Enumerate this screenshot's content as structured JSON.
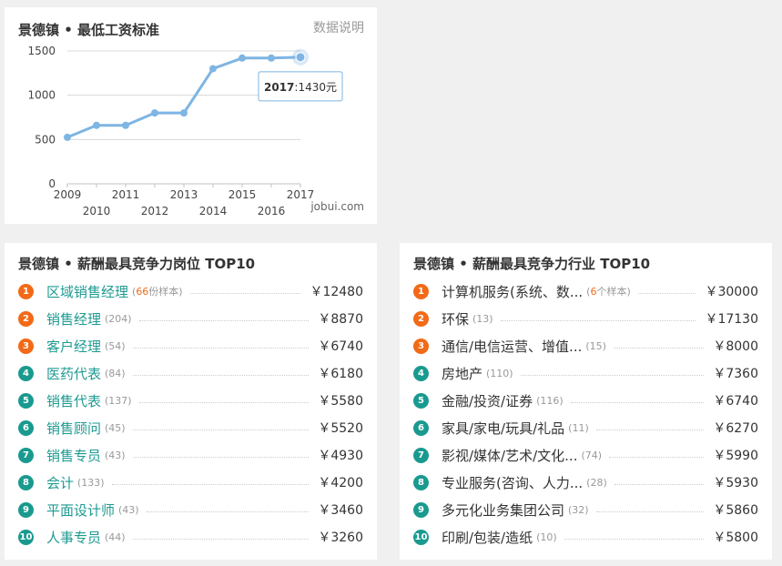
{
  "chart_panel": {
    "title": "景德镇 • 最低工资标准",
    "data_note": "数据说明",
    "source": "jobui.com",
    "tooltip_year": "2017",
    "tooltip_value": ":1430元",
    "accent": "#7eb5e3"
  },
  "chart_data": {
    "type": "line",
    "title": "景德镇 • 最低工资标准",
    "x": [
      2009,
      2010,
      2011,
      2012,
      2013,
      2014,
      2015,
      2016,
      2017
    ],
    "series": [
      {
        "values": [
          525,
          660,
          660,
          800,
          800,
          1300,
          1420,
          1420,
          1430
        ]
      }
    ],
    "x_tick_labels": [
      "2009",
      "2010",
      "2011",
      "2012",
      "2013",
      "2014",
      "2015",
      "2016",
      "2017"
    ],
    "y_ticks": [
      0,
      500,
      1000,
      1500
    ],
    "ylim": [
      0,
      1500
    ],
    "grid": true,
    "highlight_index": 8
  },
  "jobs_panel": {
    "title": "景德镇 • 薪酬最具竞争力岗位 TOP10",
    "items": [
      {
        "rank": "1",
        "name": "区域销售经理",
        "count_prefix": "(",
        "count_num": "66",
        "count_suffix": "份样本)",
        "salary": "￥12480"
      },
      {
        "rank": "2",
        "name": "销售经理",
        "count": "(204)",
        "salary": "￥8870"
      },
      {
        "rank": "3",
        "name": "客户经理",
        "count": "(54)",
        "salary": "￥6740"
      },
      {
        "rank": "4",
        "name": "医药代表",
        "count": "(84)",
        "salary": "￥6180"
      },
      {
        "rank": "5",
        "name": "销售代表",
        "count": "(137)",
        "salary": "￥5580"
      },
      {
        "rank": "6",
        "name": "销售顾问",
        "count": "(45)",
        "salary": "￥5520"
      },
      {
        "rank": "7",
        "name": "销售专员",
        "count": "(43)",
        "salary": "￥4930"
      },
      {
        "rank": "8",
        "name": "会计",
        "count": "(133)",
        "salary": "￥4200"
      },
      {
        "rank": "9",
        "name": "平面设计师",
        "count": "(43)",
        "salary": "￥3460"
      },
      {
        "rank": "10",
        "name": "人事专员",
        "count": "(44)",
        "salary": "￥3260"
      }
    ]
  },
  "industry_panel": {
    "title": "景德镇 • 薪酬最具竞争力行业 TOP10",
    "items": [
      {
        "rank": "1",
        "name": "计算机服务(系统、数...",
        "count_prefix": "(",
        "count_num": "6",
        "count_suffix": "个样本)",
        "salary": "￥30000"
      },
      {
        "rank": "2",
        "name": "环保",
        "count": "(13)",
        "salary": "￥17130"
      },
      {
        "rank": "3",
        "name": "通信/电信运营、增值...",
        "count": "(15)",
        "salary": "￥8000"
      },
      {
        "rank": "4",
        "name": "房地产",
        "count": "(110)",
        "salary": "￥7360"
      },
      {
        "rank": "5",
        "name": "金融/投资/证券",
        "count": "(116)",
        "salary": "￥6740"
      },
      {
        "rank": "6",
        "name": "家具/家电/玩具/礼品",
        "count": "(11)",
        "salary": "￥6270"
      },
      {
        "rank": "7",
        "name": "影视/媒体/艺术/文化...",
        "count": "(74)",
        "salary": "￥5990"
      },
      {
        "rank": "8",
        "name": "专业服务(咨询、人力...",
        "count": "(28)",
        "salary": "￥5930"
      },
      {
        "rank": "9",
        "name": "多元化业务集团公司",
        "count": "(32)",
        "salary": "￥5860"
      },
      {
        "rank": "10",
        "name": "印刷/包装/造纸",
        "count": "(10)",
        "salary": "￥5800"
      }
    ]
  }
}
